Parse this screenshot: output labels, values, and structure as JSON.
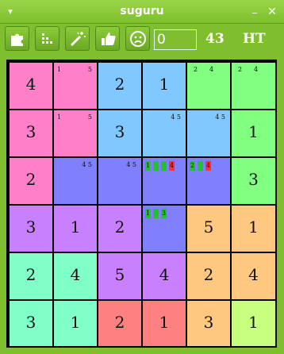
{
  "window": {
    "title": "suguru"
  },
  "toolbar": {
    "counter_value": "0",
    "count": "43",
    "level": "HT",
    "tools": [
      "puzzle-icon",
      "dots-icon",
      "magic-wand-icon",
      "thumbs-up-icon",
      "sad-face-icon"
    ]
  },
  "colors": {
    "pink": "#ff80c8",
    "blue": "#80c8ff",
    "green": "#80ff80",
    "indigo": "#8080ff",
    "purple": "#c880ff",
    "orange": "#ffc880",
    "teal": "#80ffc8",
    "red": "#ff8080",
    "lime": "#c8ff80",
    "chip_green": "#22c22f",
    "chip_red": "#ff3030"
  },
  "board": {
    "rows": [
      [
        {
          "color": "pink",
          "value": "4"
        },
        {
          "color": "pink",
          "notes": [
            "1",
            "5"
          ]
        },
        {
          "color": "blue",
          "value": "2"
        },
        {
          "color": "blue",
          "value": "1"
        },
        {
          "color": "green",
          "notes": [
            "2",
            "4"
          ]
        },
        {
          "color": "green",
          "notes": [
            "2",
            "4"
          ]
        }
      ],
      [
        {
          "color": "pink",
          "value": "3"
        },
        {
          "color": "pink",
          "notes": [
            "1",
            "5"
          ]
        },
        {
          "color": "blue",
          "value": "3"
        },
        {
          "color": "blue",
          "notes": [
            "4 5"
          ]
        },
        {
          "color": "blue",
          "notes": [
            "4 5"
          ]
        },
        {
          "color": "green",
          "value": "1"
        }
      ],
      [
        {
          "color": "pink",
          "value": "2"
        },
        {
          "color": "indigo",
          "notes": [
            "4 5"
          ]
        },
        {
          "color": "indigo",
          "notes": [
            "4 5"
          ]
        },
        {
          "color": "indigo",
          "chips": [
            {
              "t": "1",
              "c": "g"
            },
            {
              "t": "",
              "c": "g"
            },
            {
              "t": "",
              "c": "g"
            },
            {
              "t": "4",
              "c": "r"
            }
          ]
        },
        {
          "color": "indigo",
          "chips": [
            {
              "t": "2",
              "c": "g"
            },
            {
              "t": "",
              "c": "g"
            },
            {
              "t": "4",
              "c": "r"
            }
          ]
        },
        {
          "color": "green",
          "value": "3"
        }
      ],
      [
        {
          "color": "purple",
          "value": "3"
        },
        {
          "color": "purple",
          "value": "1"
        },
        {
          "color": "purple",
          "value": "2"
        },
        {
          "color": "indigo",
          "chips": [
            {
              "t": "1",
              "c": "g"
            },
            {
              "t": "",
              "c": "g"
            },
            {
              "t": "3",
              "c": "g"
            }
          ]
        },
        {
          "color": "orange",
          "value": "5"
        },
        {
          "color": "orange",
          "value": "1"
        }
      ],
      [
        {
          "color": "teal",
          "value": "2"
        },
        {
          "color": "teal",
          "value": "4"
        },
        {
          "color": "purple",
          "value": "5"
        },
        {
          "color": "purple",
          "value": "4"
        },
        {
          "color": "orange",
          "value": "2"
        },
        {
          "color": "orange",
          "value": "4"
        }
      ],
      [
        {
          "color": "teal",
          "value": "3"
        },
        {
          "color": "teal",
          "value": "1"
        },
        {
          "color": "red",
          "value": "2"
        },
        {
          "color": "red",
          "value": "1"
        },
        {
          "color": "orange",
          "value": "3"
        },
        {
          "color": "lime",
          "value": "1"
        }
      ]
    ]
  }
}
